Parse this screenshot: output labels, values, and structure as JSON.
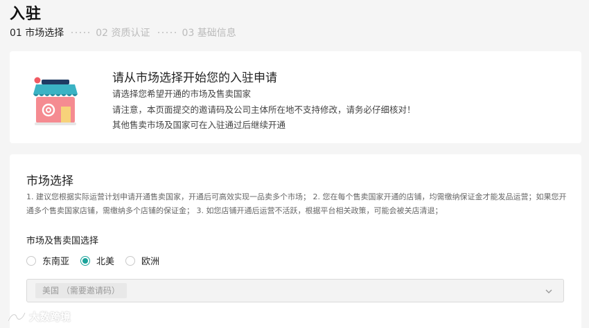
{
  "page": {
    "title": "入驻"
  },
  "steps": [
    {
      "label": "01 市场选择",
      "active": true
    },
    {
      "label": "02 资质认证",
      "active": false
    },
    {
      "label": "03 基础信息",
      "active": false
    }
  ],
  "intro": {
    "icon": "store-icon",
    "title": "请从市场选择开始您的入驻申请",
    "lines": [
      "请选择您希望开通的市场及售卖国家",
      "请注意，本页面提交的邀请码及公司主体所在地不支持修改，请务必仔细核对！",
      "其他售卖市场及国家可在入驻通过后继续开通"
    ]
  },
  "market": {
    "title": "市场选择",
    "description": "1. 建议您根据实际运营计划申请开通售卖国家，开通后可高效实现一品卖多个市场； 2. 您在每个售卖国家开通的店铺，均需缴纳保证金才能发品运营；如果您开通多个售卖国家店铺，需缴纳多个店铺的保证金； 3. 如您店铺开通后运营不活跃，根据平台相关政策，可能会被关店清退；",
    "field_label": "市场及售卖国选择",
    "options": [
      {
        "label": "东南亚",
        "checked": false
      },
      {
        "label": "北美",
        "checked": true
      },
      {
        "label": "欧洲",
        "checked": false
      }
    ],
    "select": {
      "selected_tag": "美国 （需要邀请码）"
    }
  },
  "watermark": {
    "text": "大数跨境"
  },
  "colors": {
    "accent": "#1aa39a",
    "background": "#f5f5f5"
  }
}
